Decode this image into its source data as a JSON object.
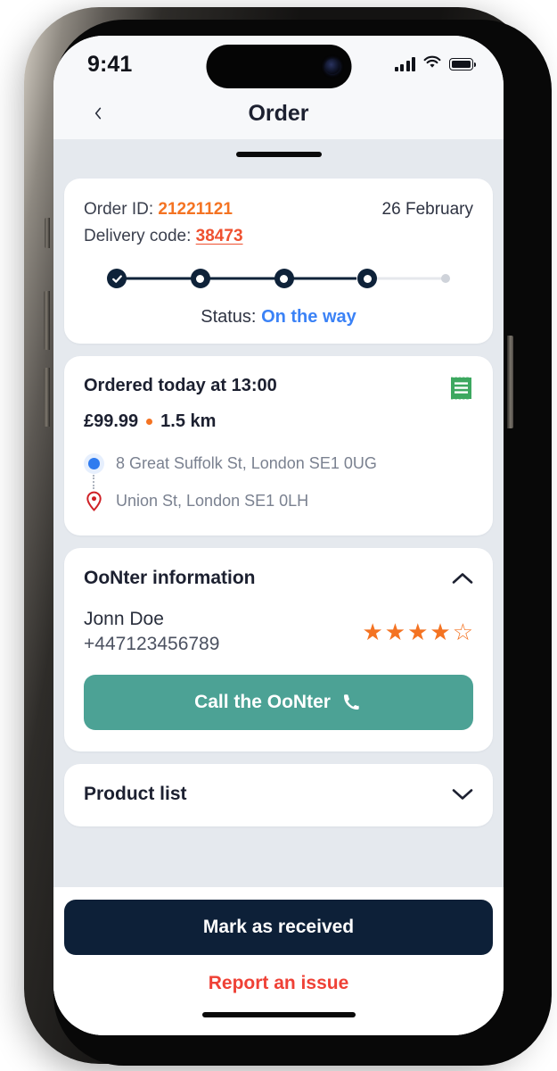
{
  "status_bar": {
    "time": "9:41",
    "signal_icon": "signal-bars-icon",
    "wifi_icon": "wifi-icon",
    "battery_icon": "battery-full-icon"
  },
  "header": {
    "back_icon": "chevron-left-icon",
    "title": "Order"
  },
  "sheet": {
    "drag_handle": "drag-handle"
  },
  "order_card": {
    "order_id_label": "Order ID:",
    "order_id_value": "21221121",
    "date": "26 February",
    "delivery_code_label": "Delivery code:",
    "delivery_code_value": "38473",
    "steps": [
      {
        "state": "done"
      },
      {
        "state": "current"
      },
      {
        "state": "current"
      },
      {
        "state": "current"
      },
      {
        "state": "pending"
      }
    ],
    "status_label": "Status:",
    "status_value": "On the way",
    "colors": {
      "order_id": "#f47322",
      "delivery_code": "#ef5130",
      "status": "#3b82f6",
      "stepper": "#0e2239"
    }
  },
  "delivery_card": {
    "ordered_title": "Ordered today at 13:00",
    "price": "£99.99",
    "distance": "1.5 km",
    "receipt_icon": "receipt-icon",
    "origin_address": "8 Great Suffolk St, London SE1 0UG",
    "destination_address": "Union St, London SE1 0LH",
    "origin_icon": "origin-dot-icon",
    "destination_icon": "map-pin-icon"
  },
  "oonter_card": {
    "title": "OoNter information",
    "toggle_icon": "chevron-up-icon",
    "expanded": true,
    "courier_name": "Jonn Doe",
    "courier_phone": "+447123456789",
    "rating_stars": [
      "★",
      "★",
      "★",
      "★",
      "☆"
    ],
    "rating_value": 4,
    "call_button_label": "Call the OoNter",
    "call_icon": "phone-icon",
    "call_button_color": "#4ca295"
  },
  "product_card": {
    "title": "Product list",
    "toggle_icon": "chevron-down-icon",
    "expanded": false
  },
  "action_bar": {
    "primary_label": "Mark as received",
    "primary_color": "#0d2038",
    "secondary_label": "Report an issue",
    "secondary_color": "#ef4136"
  }
}
